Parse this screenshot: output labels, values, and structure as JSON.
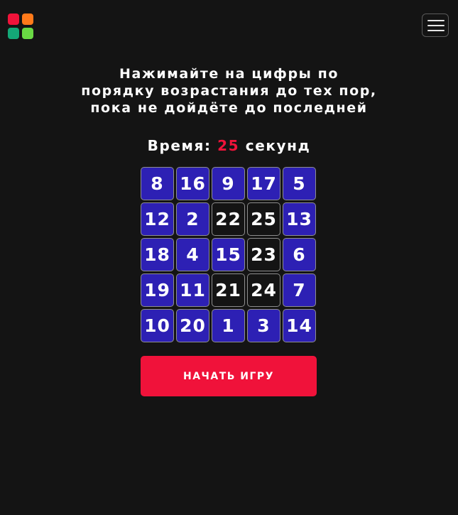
{
  "logo": {
    "colors": [
      "#f0133a",
      "#ff7a1a",
      "#14a877",
      "#6ad944"
    ]
  },
  "menu": {
    "icon": "hamburger-menu-icon"
  },
  "instructions": {
    "lines": [
      "Нажимайте на цифры по",
      "порядку возрастания до тех пор,",
      "пока не дойдёте до последней"
    ]
  },
  "timer": {
    "label": "Время:",
    "value": "25",
    "unit": "секунд",
    "value_color": "#f0133a"
  },
  "grid": {
    "rows": 5,
    "cols": 5,
    "colors": {
      "active": "#2d20b4",
      "done": "#141414"
    },
    "cells": [
      {
        "n": "8",
        "state": "active"
      },
      {
        "n": "16",
        "state": "active"
      },
      {
        "n": "9",
        "state": "active"
      },
      {
        "n": "17",
        "state": "active"
      },
      {
        "n": "5",
        "state": "active"
      },
      {
        "n": "12",
        "state": "active"
      },
      {
        "n": "2",
        "state": "active"
      },
      {
        "n": "22",
        "state": "done"
      },
      {
        "n": "25",
        "state": "done"
      },
      {
        "n": "13",
        "state": "active"
      },
      {
        "n": "18",
        "state": "active"
      },
      {
        "n": "4",
        "state": "active"
      },
      {
        "n": "15",
        "state": "active"
      },
      {
        "n": "23",
        "state": "done"
      },
      {
        "n": "6",
        "state": "active"
      },
      {
        "n": "19",
        "state": "active"
      },
      {
        "n": "11",
        "state": "active"
      },
      {
        "n": "21",
        "state": "done"
      },
      {
        "n": "24",
        "state": "done"
      },
      {
        "n": "7",
        "state": "active"
      },
      {
        "n": "10",
        "state": "active"
      },
      {
        "n": "20",
        "state": "active"
      },
      {
        "n": "1",
        "state": "active"
      },
      {
        "n": "3",
        "state": "active"
      },
      {
        "n": "14",
        "state": "active"
      }
    ]
  },
  "start_button": {
    "label": "НАЧАТЬ ИГРУ",
    "color": "#f0123a"
  }
}
